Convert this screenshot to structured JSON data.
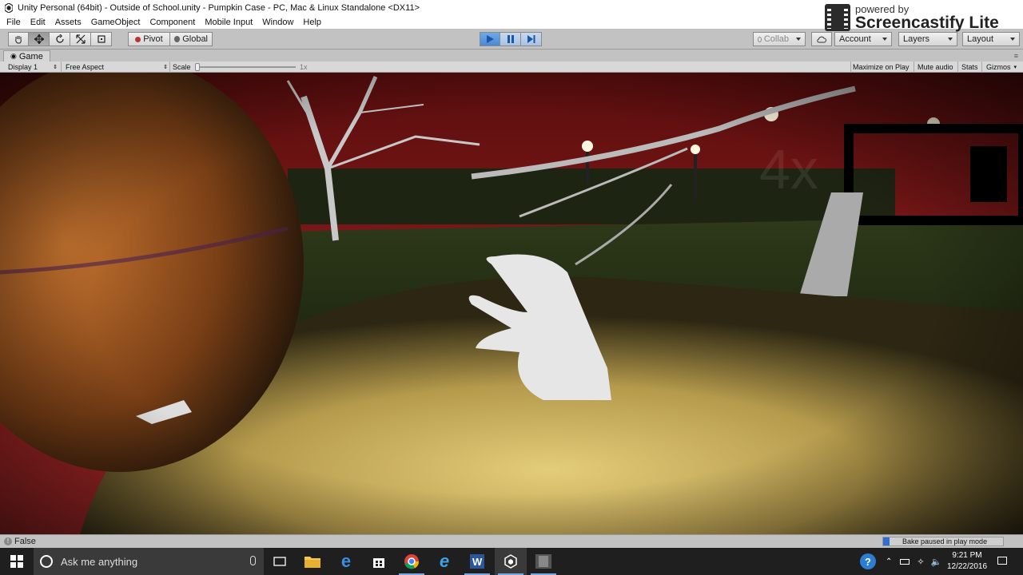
{
  "window": {
    "title": "Unity Personal (64bit) - Outside of School.unity - Pumpkin Case - PC, Mac & Linux Standalone <DX11>"
  },
  "menu": [
    "File",
    "Edit",
    "Assets",
    "GameObject",
    "Component",
    "Mobile Input",
    "Window",
    "Help"
  ],
  "watermark": {
    "line1": "powered by",
    "line2": "Screencastify Lite"
  },
  "toolbar": {
    "pivot_label": "Pivot",
    "global_label": "Global",
    "collab_label": "Collab",
    "account_label": "Account",
    "layers_label": "Layers",
    "layout_label": "Layout"
  },
  "game_tab": {
    "label": "Game"
  },
  "game_toolbar": {
    "display": "Display 1",
    "aspect": "Free Aspect",
    "scale_label": "Scale",
    "scale_value": "1x",
    "maximize": "Maximize on Play",
    "mute": "Mute audio",
    "stats": "Stats",
    "gizmos": "Gizmos"
  },
  "status": {
    "message": "False",
    "bake_text": "Bake paused in play mode",
    "bake_progress": 0.05
  },
  "taskbar": {
    "search_placeholder": "Ask me anything",
    "time": "9:21 PM",
    "date": "12/22/2016"
  },
  "colors": {
    "play_active": "#4b89d6",
    "sky": "#8e1a1a",
    "taskbar": "#1f1f1f"
  }
}
